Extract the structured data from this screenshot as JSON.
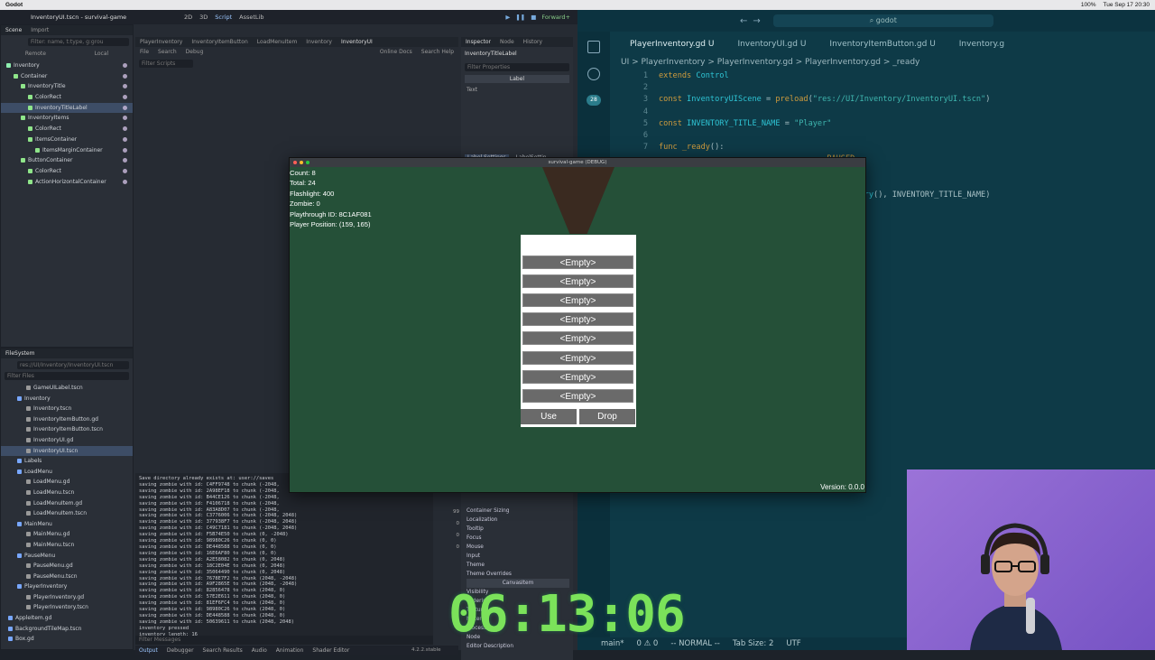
{
  "menubar": {
    "app": "Godot",
    "datetime": "Tue Sep 17 20:30",
    "battery": "100%"
  },
  "godot": {
    "title": "InventoryUI.tscn - survival-game",
    "workspaces": [
      "2D",
      "3D",
      "Script",
      "AssetLib"
    ],
    "renderer": "Forward+",
    "scene_tabs": [
      "Scene",
      "Import"
    ],
    "scene_filter": "Filter: name, t:type, g:grou",
    "scene_btns": [
      "Remote",
      "Local"
    ],
    "scene_tree": [
      {
        "label": "Inventory",
        "icon": "cyan",
        "indent": 0
      },
      {
        "label": "Container",
        "icon": "green",
        "indent": 1
      },
      {
        "label": "InventoryTitle",
        "icon": "green",
        "indent": 2
      },
      {
        "label": "ColorRect",
        "icon": "green",
        "indent": 3
      },
      {
        "label": "InventoryTitleLabel",
        "icon": "green",
        "indent": 3,
        "selected": true
      },
      {
        "label": "InventoryItems",
        "icon": "green",
        "indent": 2
      },
      {
        "label": "ColorRect",
        "icon": "green",
        "indent": 3
      },
      {
        "label": "ItemsContainer",
        "icon": "green",
        "indent": 3
      },
      {
        "label": "ItemsMarginContainer",
        "icon": "green",
        "indent": 4
      },
      {
        "label": "ButtonContainer",
        "icon": "green",
        "indent": 2
      },
      {
        "label": "ColorRect",
        "icon": "green",
        "indent": 3
      },
      {
        "label": "ActionHorizontalContainer",
        "icon": "green",
        "indent": 3
      }
    ],
    "filesystem": {
      "title": "FileSystem",
      "path": "res://UI/Inventory/InventoryUI.tscn",
      "filter": "Filter Files",
      "items": [
        {
          "label": "GameUILabel.tscn",
          "indent": 2
        },
        {
          "label": "Inventory",
          "indent": 1
        },
        {
          "label": "Inventory.tscn",
          "indent": 2
        },
        {
          "label": "InventoryItemButton.gd",
          "indent": 2
        },
        {
          "label": "InventoryItemButton.tscn",
          "indent": 2
        },
        {
          "label": "InventoryUI.gd",
          "indent": 2
        },
        {
          "label": "InventoryUI.tscn",
          "indent": 2,
          "selected": true
        },
        {
          "label": "Labels",
          "indent": 1
        },
        {
          "label": "LoadMenu",
          "indent": 1
        },
        {
          "label": "LoadMenu.gd",
          "indent": 2
        },
        {
          "label": "LoadMenu.tscn",
          "indent": 2
        },
        {
          "label": "LoadMenuItem.gd",
          "indent": 2
        },
        {
          "label": "LoadMenuItem.tscn",
          "indent": 2
        },
        {
          "label": "MainMenu",
          "indent": 1
        },
        {
          "label": "MainMenu.gd",
          "indent": 2
        },
        {
          "label": "MainMenu.tscn",
          "indent": 2
        },
        {
          "label": "PauseMenu",
          "indent": 1
        },
        {
          "label": "PauseMenu.gd",
          "indent": 2
        },
        {
          "label": "PauseMenu.tscn",
          "indent": 2
        },
        {
          "label": "PlayerInventory",
          "indent": 1
        },
        {
          "label": "PlayerInventory.gd",
          "indent": 2
        },
        {
          "label": "PlayerInventory.tscn",
          "indent": 2
        },
        {
          "label": "AppleItem.gd",
          "indent": 0
        },
        {
          "label": "BackgroundTileMap.tscn",
          "indent": 0
        },
        {
          "label": "Box.gd",
          "indent": 0
        }
      ]
    },
    "script_tabs": [
      "PlayerInventory",
      "InventoryItemButton",
      "LoadMenuItem",
      "Inventory",
      "InventoryUI"
    ],
    "script_menu": [
      "File",
      "Search",
      "Debug"
    ],
    "script_links": [
      "Online Docs",
      "Search Help"
    ],
    "filter_scripts": "Filter Scripts",
    "output_lines": [
      "Save directory already exists at: user://saves",
      "saving zombie with id: C4FF9748 to chunk (-2048,",
      "saving zombie with id: 2A98EF18 to chunk (-2048,",
      "saving zombie with id: B44CE126 to chunk (-2048,",
      "saving zombie with id: F4106718 to chunk (-2048,",
      "saving zombie with id: A83A8D07 to chunk (-2048,",
      "saving zombie with id: C3776006 to chunk (-2048, 2048)",
      "saving zombie with id: 377938F7 to chunk (-2048, 2048)",
      "saving zombie with id: C49C7181 to chunk (-2048, 2048)",
      "saving zombie with id: F5B74E50 to chunk (0, -2048)",
      "saving zombie with id: 98980C26 to chunk (0, 0)",
      "saving zombie with id: DE448588 to chunk (0, 0)",
      "saving zombie with id: 16E6AF80 to chunk (0, 0)",
      "saving zombie with id: A2E58082 to chunk (0, 2048)",
      "saving zombie with id: 18C2E04E to chunk (0, 2048)",
      "saving zombie with id: 35064490 to chunk (0, 2048)",
      "saving zombie with id: 7678E7F2 to chunk (2048, -2048)",
      "saving zombie with id: A9F2865E to chunk (2048, -2048)",
      "saving zombie with id: 82856478 to chunk (2048, 0)",
      "saving zombie with id: 57E2E611 to chunk (2048, 0)",
      "saving zombie with id: 81EF6FC4 to chunk (2048, 0)",
      "saving zombie with id: 98980C26 to chunk (2048, 0)",
      "saving zombie with id: DE448588 to chunk (2048, 0)",
      "saving zombie with id: 50639611 to chunk (2048, 2048)",
      "inventory pressed",
      "inventory length: 16"
    ],
    "output_filter": "Filter Messages",
    "bottom_tabs": [
      "Output",
      "Debugger",
      "Search Results",
      "Audio",
      "Animation",
      "Shader Editor"
    ],
    "version": "4.2.2.stable",
    "inspector": {
      "tabs": [
        "Inspector",
        "Node",
        "History"
      ],
      "node_name": "InventoryTitleLabel",
      "filter": "Filter Properties",
      "class": "Label",
      "prop": "Text",
      "label_settings": "Label Settings",
      "label_settings_value": "LabelSettin",
      "sections": [
        "Container Sizing",
        "Localization",
        "Tooltip",
        "Focus",
        "Mouse",
        "Input",
        "Theme",
        "Theme Overrides",
        "CanvasItem",
        "Visibility",
        "Ordering",
        "Texture",
        "Material",
        "Process",
        "Node",
        "Editor Description"
      ],
      "counts": [
        "99",
        "0",
        "0",
        "0"
      ]
    }
  },
  "game": {
    "window_title": "survival-game (DEBUG)",
    "hud": [
      "Count: 8",
      "Total: 24",
      "Flashlight: 400",
      "Zombie: 0",
      "Playthrough ID: 8C1AF081",
      "Player Position: (159, 165)"
    ],
    "slots": [
      "<Empty>",
      "<Empty>",
      "<Empty>",
      "<Empty>",
      "<Empty>",
      "<Empty>",
      "<Empty>",
      "<Empty>"
    ],
    "use_label": "Use",
    "drop_label": "Drop",
    "version": "Version: 0.0.0"
  },
  "vscode": {
    "search": "godot",
    "tabs": [
      "PlayerInventory.gd U",
      "InventoryUI.gd U",
      "InventoryItemButton.gd U",
      "Inventory.g"
    ],
    "breadcrumb": "UI > PlayerInventory > PlayerInventory.gd > PlayerInventory.gd > _ready",
    "badge": "28",
    "code": [
      {
        "ln": "1",
        "parts": [
          [
            "kw",
            "extends "
          ],
          [
            "id",
            "Control"
          ]
        ]
      },
      {
        "ln": "2",
        "parts": []
      },
      {
        "ln": "3",
        "parts": [
          [
            "kw",
            "const "
          ],
          [
            "id",
            "InventoryUIScene"
          ],
          [
            "plain",
            " = "
          ],
          [
            "fn",
            "preload"
          ],
          [
            "plain",
            "("
          ],
          [
            "str",
            "\"res://UI/Inventory/InventoryUI.tscn\""
          ],
          [
            "plain",
            ")"
          ]
        ]
      },
      {
        "ln": "4",
        "parts": []
      },
      {
        "ln": "5",
        "parts": [
          [
            "kw",
            "const "
          ],
          [
            "id",
            "INVENTORY_TITLE_NAME"
          ],
          [
            "plain",
            " = "
          ],
          [
            "str",
            "\"Player\""
          ]
        ]
      },
      {
        "ln": "6",
        "parts": []
      },
      {
        "ln": "7",
        "parts": [
          [
            "kw",
            "func "
          ],
          [
            "fn",
            "_ready"
          ],
          [
            "plain",
            "():"
          ]
        ]
      },
      {
        "ln": "",
        "parts": [
          [
            "plain",
            "                                    "
          ],
          [
            "kw",
            "PAUSED"
          ]
        ]
      },
      {
        "ln": "",
        "parts": []
      },
      {
        "ln": "",
        "parts": [
          [
            "plain",
            "                                    "
          ],
          [
            "plain",
            "e()"
          ]
        ]
      },
      {
        "ln": "",
        "parts": [
          [
            "plain",
            "                                    "
          ],
          [
            "id",
            "_inventory"
          ],
          [
            "plain",
            "(), INVENTORY_TITLE_NAME)"
          ]
        ]
      }
    ],
    "status": [
      "main*",
      "0 ⚠ 0",
      "-- NORMAL --",
      "Tab Size: 2",
      "UTF"
    ]
  },
  "stream": {
    "timer": "06:13:06"
  }
}
